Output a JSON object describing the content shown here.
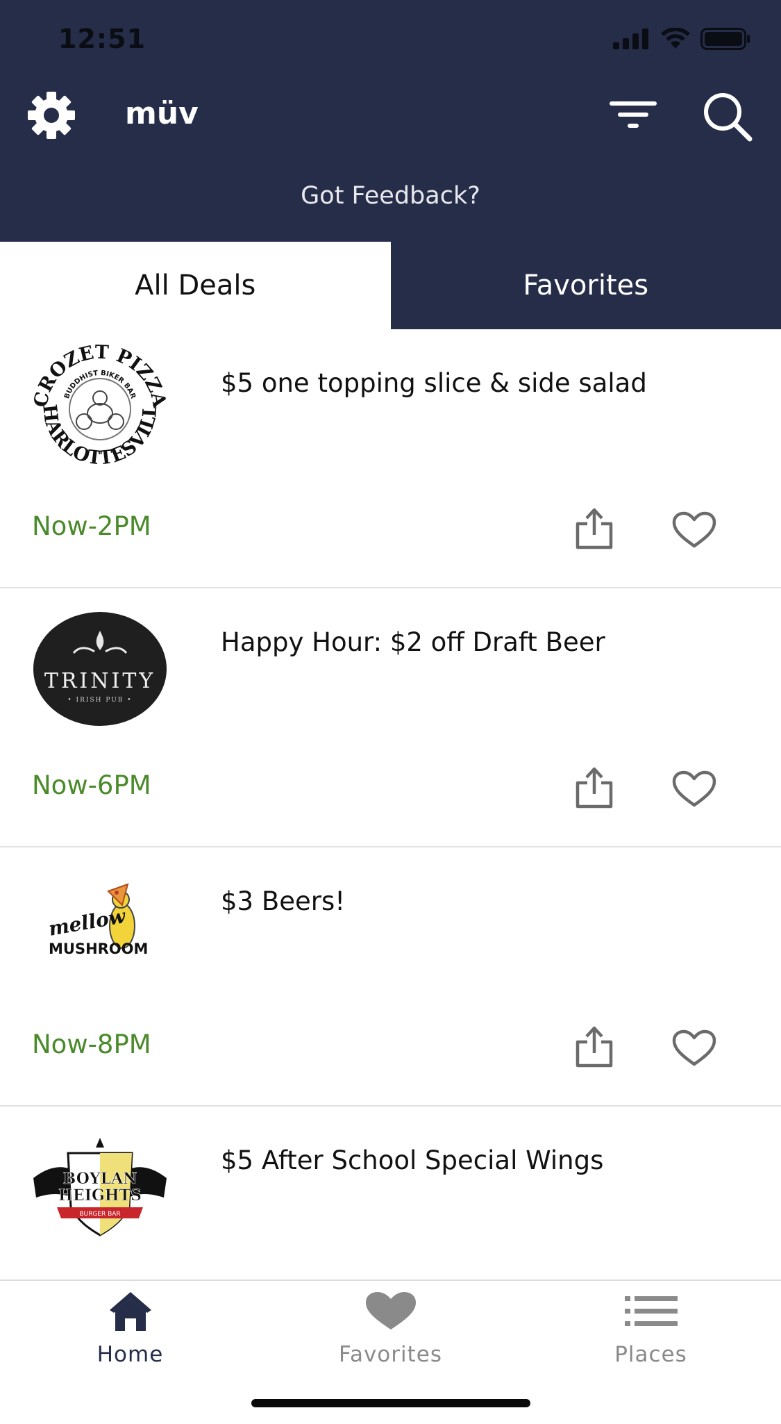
{
  "status_bar": {
    "time": "12:51"
  },
  "topbar": {
    "title": "müv",
    "feedback": "Got Feedback?"
  },
  "tabs": [
    {
      "label": "All Deals",
      "active": true
    },
    {
      "label": "Favorites",
      "active": false
    }
  ],
  "deals": [
    {
      "title": "$5 one topping slice & side salad",
      "time": "Now-2PM",
      "logo": {
        "line1": "CROZET PIZZA",
        "line2": "BUDDHIST BIKER BAR",
        "line3": "CHARLOTTESVILLE"
      }
    },
    {
      "title": "Happy Hour: $2 off Draft Beer",
      "time": "Now-6PM",
      "logo": {
        "line1": "TRINITY",
        "line2": "• IRISH PUB •"
      }
    },
    {
      "title": "$3 Beers!",
      "time": "Now-8PM",
      "logo": {
        "line1": "mellow",
        "line2": "MUSHROOM"
      }
    },
    {
      "title": "$5 After School Special Wings",
      "time": "",
      "logo": {
        "line1": "BOYLAN",
        "line2": "HEIGHTS",
        "line3": "BURGER BAR"
      }
    }
  ],
  "bottom_nav": [
    {
      "label": "Home",
      "active": true
    },
    {
      "label": "Favorites",
      "active": false
    },
    {
      "label": "Places",
      "active": false
    }
  ],
  "colors": {
    "header_bg": "#262d48",
    "time_green": "#4a8a2a",
    "nav_active": "#262d48",
    "nav_inactive": "#8a8a8a"
  }
}
